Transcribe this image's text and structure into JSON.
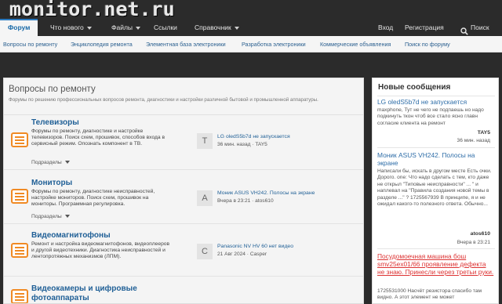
{
  "brand": {
    "logo": "monitor.net.ru"
  },
  "nav": {
    "items": [
      {
        "label": "Форум",
        "active": true
      },
      {
        "label": "Что нового",
        "dropdown": true
      },
      {
        "label": "Файлы",
        "dropdown": true
      },
      {
        "label": "Ссылки"
      },
      {
        "label": "Справочник",
        "dropdown": true
      }
    ],
    "login": "Вход",
    "register": "Регистрация",
    "search": "Поиск"
  },
  "subnav": [
    "Вопросы по ремонту",
    "Энциклопедия ремонта",
    "Элементная база электроники",
    "Разработка электроники",
    "Коммерческие объявления",
    "Поиск по форуму"
  ],
  "category": {
    "title": "Вопросы по ремонту",
    "description": "Форумы по решению профессиональных вопросов ремонта, диагностики и настройки различной бытовой и промышленной аппаратуры."
  },
  "nodes": [
    {
      "title": "Телевизоры",
      "description": "Форумы по ремонту, диагностике и настройке телевизоров. Поиск схем, прошивок, способов входа в сервисный режим. Опознать компонент в ТВ.",
      "subforums": "Подразделы",
      "avatar": "T",
      "last_title": "LG oledS5b7d не запускается",
      "last_meta": "36 мин. назад · TAY5"
    },
    {
      "title": "Мониторы",
      "description": "Форумы по ремонту, диагностике неисправностей, настройке мониторов. Поиск схем, прошивок на мониторы. Программная регулировка.",
      "subforums": "Подразделы",
      "avatar": "A",
      "last_title": "Моник ASUS VH242. Полосы на экране",
      "last_meta": "Вчера в 23:21 · atos610"
    },
    {
      "title": "Видеомагнитофоны",
      "description": "Ремонт и настройка видеомагнитофонов, видеоплееров и другой видеотехники. Диагностика неисправностей и лентопротяжных механизмов (ЛПМ).",
      "subforums": "",
      "avatar": "C",
      "last_title": "Panasonic NV HV 60 нет видео",
      "last_meta": "21 Авг 2024 · Casper"
    },
    {
      "title": "Видеокамеры и цифровые фотоаппараты",
      "description": "",
      "subforums": "",
      "avatar": "",
      "last_title": "",
      "last_meta": ""
    }
  ],
  "sidebar": {
    "title": "Новые сообщения",
    "posts": [
      {
        "title": "LG oledS5b7d не запускается",
        "text": "maxphone, Тут не чего не подпаешь но надо подкинуть ткон чтоб все стало ясно главн согласие клиента на ремонт",
        "author": "TAY5",
        "time": "36 мин. назад"
      },
      {
        "title": "Моник ASUS VH242. Полосы на экране",
        "text": "Написали бы, искать в другом месте Есть очки. Дорого. one: Что надо сделать с тем, кто даже не открыл \"Типовые неисправности\" ... \" и наплевал на \"Правила создания новой темы в разделе ...\" ? 1725567939 В принципе, я и не ожидал какого-то полезного ответа. Обычно...",
        "author": "atos610",
        "time": "Вчера в 23:21"
      },
      {
        "title": "Посудомоечная машина бош smv25ex01/66 проявление дефекта не знаю. Принесли через третьи руки.",
        "text": "1725531000 Насчёт резистора спасибо там видно. А этот элемент не может",
        "author": "",
        "time": ""
      }
    ]
  },
  "colors": {
    "accent": "#2b7ac0",
    "link": "#1f5f96",
    "icon": "#f08a24",
    "alert": "#dd3333"
  }
}
